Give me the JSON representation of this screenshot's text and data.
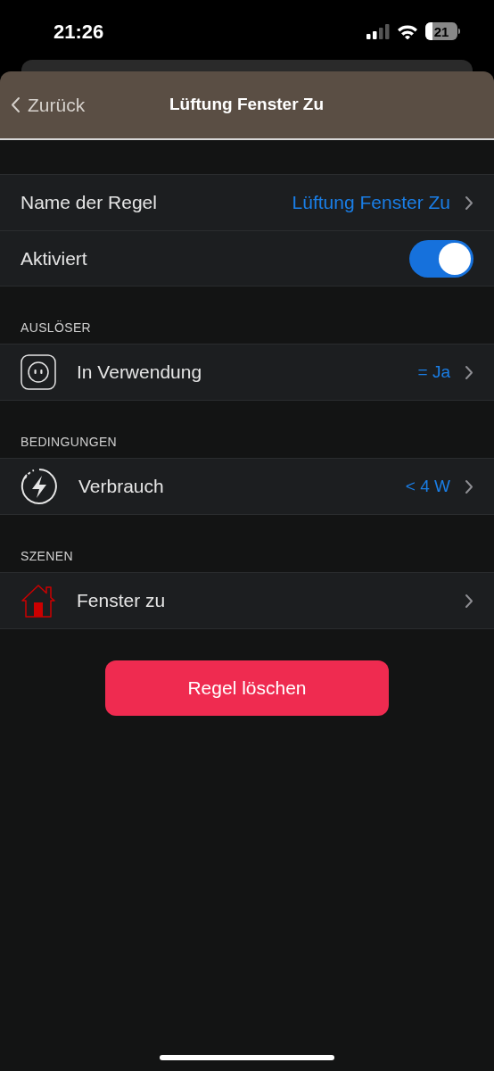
{
  "status_bar": {
    "time": "21:26",
    "battery": "21"
  },
  "nav": {
    "back": "Zurück",
    "title": "Lüftung Fenster Zu"
  },
  "settings": [
    {
      "kind": "value",
      "label": "Name der Regel",
      "value": "Lüftung Fenster Zu"
    },
    {
      "kind": "toggle",
      "label": "Aktiviert",
      "on": true
    }
  ],
  "sections": [
    {
      "title": "AUSLÖSER",
      "items": [
        {
          "kind": "socket",
          "label": "In Verwendung",
          "value": "= Ja"
        }
      ]
    },
    {
      "title": "BEDINGUNGEN",
      "items": [
        {
          "kind": "bolt",
          "label": "Verbrauch",
          "value": "< 4 W"
        }
      ]
    },
    {
      "title": "SZENEN",
      "items": [
        {
          "kind": "house",
          "label": "Fenster zu"
        }
      ]
    }
  ],
  "delete_button": "Regel löschen"
}
